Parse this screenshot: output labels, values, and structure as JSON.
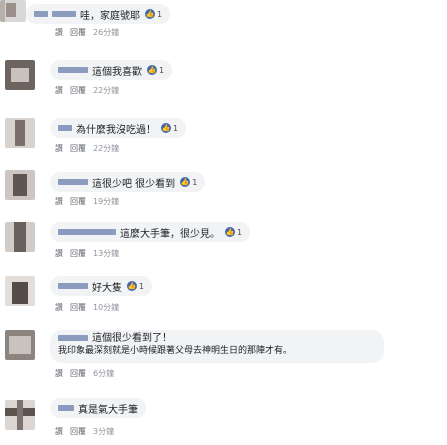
{
  "comments": [
    {
      "text": "哇，家庭號耶",
      "reactions": "1",
      "actions": [
        "讚",
        "回覆"
      ],
      "time": "26分鐘"
    },
    {
      "text": "這個我喜歡",
      "reactions": "1",
      "actions": [
        "讚",
        "回覆"
      ],
      "time": "22分鐘"
    },
    {
      "text": "為什麼我沒吃過！",
      "reactions": "1",
      "actions": [
        "讚",
        "回覆"
      ],
      "time": "22分鐘"
    },
    {
      "text": "這很少吧 很少看到",
      "reactions": "1",
      "actions": [
        "讚",
        "回覆"
      ],
      "time": "19分鐘"
    },
    {
      "text": "這麼大手筆，很少見。",
      "reactions": "1",
      "actions": [
        "讚",
        "回覆"
      ],
      "time": "13分鐘"
    },
    {
      "text": "好大隻",
      "reactions": "1",
      "actions": [
        "讚",
        "回覆"
      ],
      "time": "10分鐘"
    },
    {
      "text": "這個很少看到了！",
      "text2": "我印象最深刻就是小時候跟著父母去神明生日的那陣才有。",
      "reactions": "",
      "actions": [
        "讚",
        "回覆"
      ],
      "time": "6分鐘"
    },
    {
      "text": "真是氣大手筆",
      "reactions": "",
      "actions": [
        "讚",
        "回覆"
      ],
      "time": "3分鐘"
    }
  ],
  "colors": {
    "bubble": "#f2f3f5",
    "link": "#3b5998",
    "like": "#4267b2"
  },
  "icons": {
    "reaction": "like-icon"
  }
}
